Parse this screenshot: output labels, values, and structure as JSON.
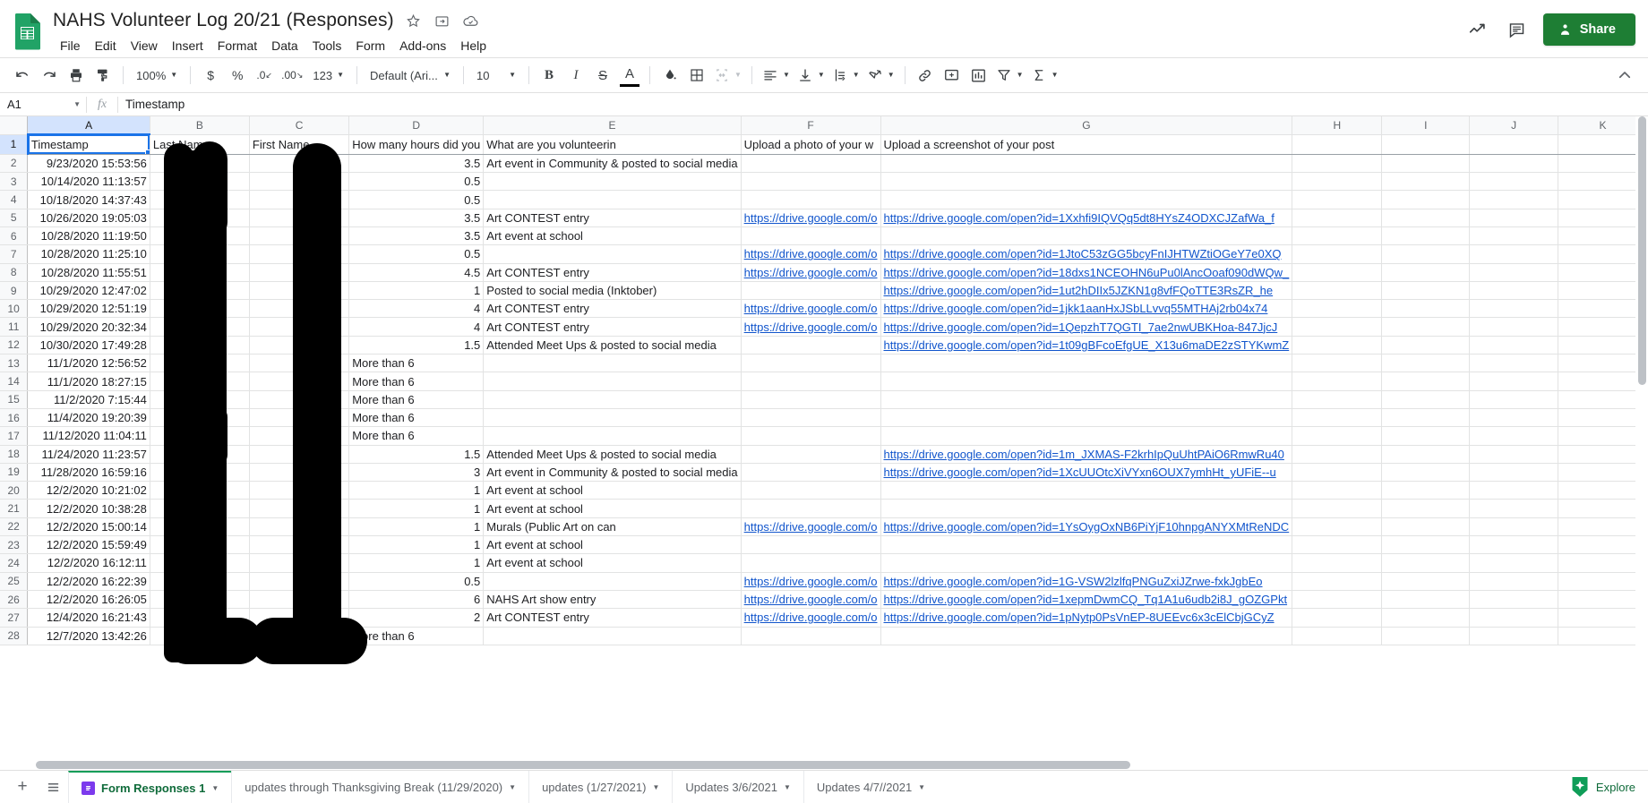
{
  "app": {
    "title": "NAHS Volunteer Log 20/21 (Responses)",
    "accent_green": "#1e7e34",
    "link_blue": "#1155cc",
    "selection_blue": "#1a73e8"
  },
  "title_icons": [
    {
      "name": "star-icon",
      "glyph": "☆"
    },
    {
      "name": "move-to-folder-icon",
      "glyph": "↱"
    },
    {
      "name": "cloud-saved-icon",
      "glyph": "☁"
    }
  ],
  "menu": [
    "File",
    "Edit",
    "View",
    "Insert",
    "Format",
    "Data",
    "Tools",
    "Form",
    "Add-ons",
    "Help"
  ],
  "title_right": {
    "activity_icon": "activity-chart-icon",
    "comment_icon": "comment-icon",
    "share_label": "Share"
  },
  "toolbar": {
    "undo": "undo-icon",
    "redo": "redo-icon",
    "print": "print-icon",
    "paint_format": "paint-format-icon",
    "zoom": "100%",
    "currency": "$",
    "percent": "%",
    "decimal_decrease": ".0",
    "decimal_increase": ".00",
    "more_formats": "123",
    "font": "Default (Ari...",
    "font_size": "10",
    "bold": "B",
    "italic": "I",
    "strikethrough": "S",
    "text_color": "A",
    "fill_color": "fill-color-icon",
    "borders": "borders-icon",
    "merge_cells": "merge-cells-icon",
    "horizontal_align": "horizontal-align-icon",
    "vertical_align": "vertical-align-icon",
    "text_wrap": "text-wrapping-icon",
    "text_rotation": "text-rotation-icon",
    "insert_link": "insert-link-icon",
    "insert_comment": "insert-comment-icon",
    "insert_chart": "insert-chart-icon",
    "create_filter": "filter-icon",
    "functions": "functions-sigma-icon",
    "collapse": "collapse-toolbar-icon"
  },
  "formula_bar": {
    "name_box": "A1",
    "fx": "fx",
    "value": "Timestamp"
  },
  "grid": {
    "columns": [
      "A",
      "B",
      "C",
      "D",
      "E",
      "F",
      "G",
      "H",
      "I",
      "J",
      "K"
    ],
    "selected_column": "A",
    "selected_row": 1,
    "selected_cell": "A1",
    "row_numbers": [
      1,
      2,
      3,
      4,
      5,
      6,
      7,
      8,
      9,
      10,
      11,
      12,
      13,
      14,
      15,
      16,
      17,
      18,
      19,
      20,
      21,
      22,
      23,
      24,
      25,
      26,
      27,
      28
    ],
    "header_row": [
      "Timestamp",
      "Last Name",
      "First Name",
      "How many hours did you",
      "What are you volunteerin",
      "Upload a photo of your w",
      "Upload a screenshot of your post",
      "",
      "",
      "",
      ""
    ],
    "rows": [
      {
        "n": 2,
        "a": "9/23/2020 15:53:56",
        "b": "",
        "c": "",
        "d": "3.5",
        "e": "Art event in Community & posted to social media",
        "f": "",
        "g": ""
      },
      {
        "n": 3,
        "a": "10/14/2020 11:13:57",
        "b": "",
        "c": "",
        "d": "0.5",
        "e": "",
        "f": "",
        "g": ""
      },
      {
        "n": 4,
        "a": "10/18/2020 14:37:43",
        "b": "",
        "c": "",
        "d": "0.5",
        "e": "",
        "f": "",
        "g": ""
      },
      {
        "n": 5,
        "a": "10/26/2020 19:05:03",
        "b": "",
        "c": "",
        "d": "3.5",
        "e": "Art CONTEST entry",
        "f": "https://drive.google.com/o",
        "g": "https://drive.google.com/open?id=1Xxhfi9IQVQq5dt8HYsZ4ODXCJZafWa_f"
      },
      {
        "n": 6,
        "a": "10/28/2020 11:19:50",
        "b": "",
        "c": "",
        "d": "3.5",
        "e": "Art event at school",
        "f": "",
        "g": ""
      },
      {
        "n": 7,
        "a": "10/28/2020 11:25:10",
        "b": "",
        "c": "",
        "d": "0.5",
        "e": "",
        "f": "https://drive.google.com/o",
        "g": "https://drive.google.com/open?id=1JtoC53zGG5bcyFnIJHTWZtiOGeY7e0XQ"
      },
      {
        "n": 8,
        "a": "10/28/2020 11:55:51",
        "b": "",
        "c": "",
        "d": "4.5",
        "e": "Art CONTEST entry",
        "f": "https://drive.google.com/o",
        "g": "https://drive.google.com/open?id=18dxs1NCEOHN6uPu0lAncOoaf090dWQw_"
      },
      {
        "n": 9,
        "a": "10/29/2020 12:47:02",
        "b": "",
        "c": "",
        "d": "1",
        "e": "Posted to social media (Inktober)",
        "f": "",
        "g": "https://drive.google.com/open?id=1ut2hDIIx5JZKN1g8vfFQoTTE3RsZR_he"
      },
      {
        "n": 10,
        "a": "10/29/2020 12:51:19",
        "b": "",
        "c": "",
        "d": "4",
        "e": "Art CONTEST entry",
        "f": "https://drive.google.com/o",
        "g": "https://drive.google.com/open?id=1jkk1aanHxJSbLLvvq55MTHAj2rb04x74"
      },
      {
        "n": 11,
        "a": "10/29/2020 20:32:34",
        "b": "",
        "c": "",
        "d": "4",
        "e": "Art CONTEST entry",
        "f": "https://drive.google.com/o",
        "g": "https://drive.google.com/open?id=1QepzhT7QGTI_7ae2nwUBKHoa-847JjcJ"
      },
      {
        "n": 12,
        "a": "10/30/2020 17:49:28",
        "b": "",
        "c": "",
        "d": "1.5",
        "e": "Attended Meet Ups & posted to social media",
        "f": "",
        "g": "https://drive.google.com/open?id=1t09gBFcoEfgUE_X13u6maDE2zSTYKwmZ"
      },
      {
        "n": 13,
        "a": "11/1/2020 12:56:52",
        "b": "",
        "c": "",
        "d": "More than 6",
        "e": "",
        "f": "",
        "g": ""
      },
      {
        "n": 14,
        "a": "11/1/2020 18:27:15",
        "b": "",
        "c": "",
        "d": "More than 6",
        "e": "",
        "f": "",
        "g": ""
      },
      {
        "n": 15,
        "a": "11/2/2020 7:15:44",
        "b": "",
        "c": "",
        "d": "More than 6",
        "e": "",
        "f": "",
        "g": ""
      },
      {
        "n": 16,
        "a": "11/4/2020 19:20:39",
        "b": "",
        "c": "",
        "d": "More than 6",
        "e": "",
        "f": "",
        "g": ""
      },
      {
        "n": 17,
        "a": "11/12/2020 11:04:11",
        "b": "",
        "c": "",
        "d": "More than 6",
        "e": "",
        "f": "",
        "g": ""
      },
      {
        "n": 18,
        "a": "11/24/2020 11:23:57",
        "b": "",
        "c": "",
        "d": "1.5",
        "e": "Attended Meet Ups & posted to social media",
        "f": "",
        "g": "https://drive.google.com/open?id=1m_JXMAS-F2krhIpQuUhtPAiO6RmwRu40"
      },
      {
        "n": 19,
        "a": "11/28/2020 16:59:16",
        "b": "",
        "c": "",
        "d": "3",
        "e": "Art event in Community & posted to social media",
        "f": "",
        "g": "https://drive.google.com/open?id=1XcUUOtcXiVYxn6OUX7ymhHt_yUFiE--u"
      },
      {
        "n": 20,
        "a": "12/2/2020 10:21:02",
        "b": "",
        "c": "",
        "d": "1",
        "e": "Art event at school",
        "f": "",
        "g": ""
      },
      {
        "n": 21,
        "a": "12/2/2020 10:38:28",
        "b": "",
        "c": "",
        "d": "1",
        "e": "Art event at school",
        "f": "",
        "g": ""
      },
      {
        "n": 22,
        "a": "12/2/2020 15:00:14",
        "b": "",
        "c": "",
        "d": "1",
        "e": "Murals (Public Art on can",
        "f": "https://drive.google.com/o",
        "g": "https://drive.google.com/open?id=1YsOygOxNB6PiYjF10hnpgANYXMtReNDC"
      },
      {
        "n": 23,
        "a": "12/2/2020 15:59:49",
        "b": "",
        "c": "",
        "d": "1",
        "e": "Art event at school",
        "f": "",
        "g": ""
      },
      {
        "n": 24,
        "a": "12/2/2020 16:12:11",
        "b": "",
        "c": "",
        "d": "1",
        "e": "Art event at school",
        "f": "",
        "g": ""
      },
      {
        "n": 25,
        "a": "12/2/2020 16:22:39",
        "b": "",
        "c": "",
        "d": "0.5",
        "e": "",
        "f": "https://drive.google.com/o",
        "g": "https://drive.google.com/open?id=1G-VSW2lzlfqPNGuZxiJZrwe-fxkJgbEo"
      },
      {
        "n": 26,
        "a": "12/2/2020 16:26:05",
        "b": "",
        "c": "",
        "d": "6",
        "e": "NAHS Art show entry",
        "f": "https://drive.google.com/o",
        "g": "https://drive.google.com/open?id=1xepmDwmCQ_Tq1A1u6udb2i8J_gOZGPkt"
      },
      {
        "n": 27,
        "a": "12/4/2020 16:21:43",
        "b": "",
        "c": "",
        "d": "2",
        "e": "Art CONTEST entry",
        "f": "https://drive.google.com/o",
        "g": "https://drive.google.com/open?id=1pNytp0PsVnEP-8UEEvc6x3cElCbjGCyZ"
      },
      {
        "n": 28,
        "a": "12/7/2020 13:42:26",
        "b": "",
        "c": "",
        "d": "More than 6",
        "e": "",
        "f": "",
        "g": ""
      }
    ]
  },
  "tabs": {
    "add_sheet": "add-sheet-icon",
    "all_sheets": "all-sheets-icon",
    "items": [
      {
        "label": "Form Responses 1",
        "active": true,
        "has_form_icon": true
      },
      {
        "label": "updates through Thanksgiving Break (11/29/2020)",
        "active": false,
        "has_form_icon": false
      },
      {
        "label": "updates (1/27/2021)",
        "active": false,
        "has_form_icon": false
      },
      {
        "label": "Updates 3/6/2021",
        "active": false,
        "has_form_icon": false
      },
      {
        "label": "Updates 4/7//2021",
        "active": false,
        "has_form_icon": false
      }
    ],
    "explore_label": "Explore"
  }
}
